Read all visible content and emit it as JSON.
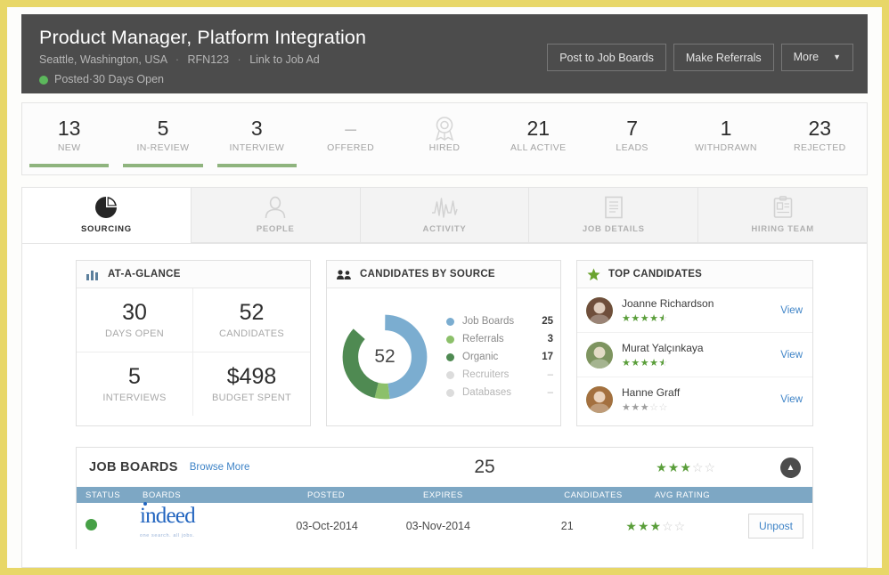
{
  "header": {
    "title": "Product Manager, Platform Integration",
    "location": "Seattle, Washington, USA",
    "req_id": "RFN123",
    "job_ad_link": "Link to Job Ad",
    "status": "Posted",
    "days_open": "30 Days Open",
    "separator": "·",
    "status_color": "#5cb85c",
    "buttons": {
      "post": "Post to Job Boards",
      "referrals": "Make Referrals",
      "more": "More"
    }
  },
  "stats": [
    {
      "value": "13",
      "label": "NEW",
      "bar": true,
      "icon": null
    },
    {
      "value": "5",
      "label": "IN-REVIEW",
      "bar": true,
      "icon": null
    },
    {
      "value": "3",
      "label": "INTERVIEW",
      "bar": true,
      "icon": null
    },
    {
      "value": "–",
      "label": "OFFERED",
      "bar": false,
      "icon": null
    },
    {
      "value": "",
      "label": "HIRED",
      "bar": false,
      "icon": "award-ribbon-icon"
    },
    {
      "value": "21",
      "label": "ALL ACTIVE",
      "bar": false,
      "icon": null
    },
    {
      "value": "7",
      "label": "LEADS",
      "bar": false,
      "icon": null
    },
    {
      "value": "1",
      "label": "WITHDRAWN",
      "bar": false,
      "icon": null
    },
    {
      "value": "23",
      "label": "REJECTED",
      "bar": false,
      "icon": null
    }
  ],
  "tabs": [
    {
      "label": "SOURCING",
      "icon": "pie-chart-icon",
      "active": true
    },
    {
      "label": "PEOPLE",
      "icon": "person-icon",
      "active": false
    },
    {
      "label": "ACTIVITY",
      "icon": "pulse-icon",
      "active": false
    },
    {
      "label": "JOB DETAILS",
      "icon": "document-icon",
      "active": false
    },
    {
      "label": "HIRING TEAM",
      "icon": "clipboard-id-icon",
      "active": false
    }
  ],
  "at_a_glance": {
    "title": "AT-A-GLANCE",
    "icon": "bar-chart-icon",
    "cells": [
      {
        "value": "30",
        "label": "DAYS OPEN"
      },
      {
        "value": "52",
        "label": "CANDIDATES"
      },
      {
        "value": "5",
        "label": "INTERVIEWS"
      },
      {
        "value": "$498",
        "label": "BUDGET SPENT"
      }
    ]
  },
  "candidates_by_source": {
    "title": "CANDIDATES BY SOURCE",
    "icon": "people-group-icon",
    "center_total": "52"
  },
  "chart_data": {
    "type": "pie",
    "title": "Candidates by Source",
    "total": 52,
    "categories": [
      "Job Boards",
      "Referrals",
      "Organic",
      "Recruiters",
      "Databases"
    ],
    "values": [
      25,
      3,
      17,
      0,
      0
    ],
    "display_values": [
      "25",
      "3",
      "17",
      "–",
      "–"
    ],
    "colors": [
      "#7badd0",
      "#8cc06a",
      "#4f8a52",
      "#dcdcdc",
      "#dcdcdc"
    ],
    "legend_position": "right",
    "donut": true
  },
  "top_candidates": {
    "title": "TOP CANDIDATES",
    "icon": "star-icon",
    "view_label": "View",
    "rows": [
      {
        "name": "Joanne Richardson",
        "rating": 4.5,
        "rating_style": "green",
        "avatar_color": "#6f4e3b"
      },
      {
        "name": "Murat Yalçınkaya",
        "rating": 4.5,
        "rating_style": "green",
        "avatar_color": "#7e9460"
      },
      {
        "name": "Hanne Graff",
        "rating": 3,
        "rating_style": "gray",
        "avatar_color": "#a4703f"
      }
    ]
  },
  "job_boards": {
    "title": "JOB BOARDS",
    "browse_more": "Browse More",
    "total_candidates": "25",
    "avg_rating": 3,
    "collapse_icon": "chevron-up-icon",
    "columns": [
      "STATUS",
      "BOARDS",
      "POSTED",
      "EXPIRES",
      "CANDIDATES",
      "AVG RATING",
      ""
    ],
    "rows": [
      {
        "status": "active",
        "board": "indeed",
        "board_tagline": "one search. all jobs.",
        "posted": "03-Oct-2014",
        "expires": "03-Nov-2014",
        "candidates": "21",
        "rating": 3,
        "action": "Unpost"
      }
    ]
  },
  "colors": {
    "header_bg": "#4c4c4c",
    "accent_green": "#8fb47e",
    "link_blue": "#3f84c7",
    "table_header_blue": "#7da7c4",
    "frame_gold": "#e8d768"
  }
}
